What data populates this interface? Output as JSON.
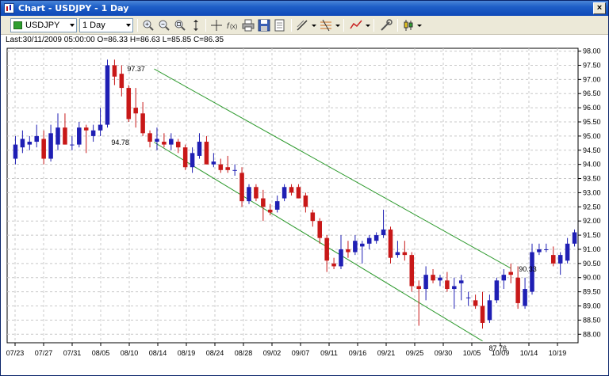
{
  "window": {
    "title": "Chart - USDJPY - 1 Day",
    "close_glyph": "×"
  },
  "toolbar": {
    "symbol": "USDJPY",
    "timeframe": "1 Day",
    "icons": [
      "zoom-in-icon",
      "zoom-out-icon",
      "zoom-fit-icon",
      "autoscale-icon",
      "crosshair-icon",
      "function-icon",
      "print-icon",
      "save-icon",
      "properties-icon",
      "draw-line-icon",
      "fibonacci-icon",
      "indicator-icon",
      "settings-icon",
      "candle-type-icon"
    ]
  },
  "infobar": {
    "text": "Last:30/11/2009 05:00:00 O=86.33 H=86.63 L=85.85 C=86.35"
  },
  "colors": {
    "bull": "#1f1fb4",
    "bear": "#c81818",
    "channel": "#2e9a2e",
    "grid": "#c8c8c8"
  },
  "chart_data": {
    "type": "candlestick",
    "ylim": [
      87.7,
      98.1
    ],
    "y_ticks": [
      "98.00",
      "97.50",
      "97.00",
      "96.50",
      "96.00",
      "95.50",
      "95.00",
      "94.50",
      "94.00",
      "93.50",
      "93.00",
      "92.50",
      "92.00",
      "91.50",
      "91.00",
      "90.50",
      "90.00",
      "89.50",
      "89.00",
      "88.50",
      "88.00"
    ],
    "x_ticks": [
      "07/23",
      "07/27",
      "07/31",
      "08/05",
      "08/10",
      "08/14",
      "08/19",
      "08/24",
      "08/28",
      "09/02",
      "09/07",
      "09/11",
      "09/16",
      "09/21",
      "09/25",
      "09/30",
      "10/05",
      "10/09",
      "10/14",
      "10/19"
    ],
    "candles": [
      {
        "o": 94.2,
        "h": 95.0,
        "l": 94.0,
        "c": 94.7
      },
      {
        "o": 94.6,
        "h": 95.2,
        "l": 94.4,
        "c": 94.9
      },
      {
        "o": 94.7,
        "h": 95.0,
        "l": 94.5,
        "c": 94.8
      },
      {
        "o": 94.8,
        "h": 95.4,
        "l": 94.6,
        "c": 95.0
      },
      {
        "o": 94.9,
        "h": 95.2,
        "l": 94.0,
        "c": 94.2
      },
      {
        "o": 94.2,
        "h": 95.4,
        "l": 94.1,
        "c": 95.1
      },
      {
        "o": 94.7,
        "h": 95.8,
        "l": 94.5,
        "c": 95.3
      },
      {
        "o": 95.3,
        "h": 95.8,
        "l": 94.7,
        "c": 94.7
      },
      {
        "o": 94.7,
        "h": 95.0,
        "l": 94.5,
        "c": 94.7
      },
      {
        "o": 94.7,
        "h": 95.5,
        "l": 94.6,
        "c": 95.3
      },
      {
        "o": 95.3,
        "h": 95.4,
        "l": 94.4,
        "c": 95.2
      },
      {
        "o": 95.0,
        "h": 95.4,
        "l": 94.8,
        "c": 95.2
      },
      {
        "o": 95.2,
        "h": 96.0,
        "l": 95.0,
        "c": 95.4
      },
      {
        "o": 95.4,
        "h": 97.7,
        "l": 95.3,
        "c": 97.5
      },
      {
        "o": 97.5,
        "h": 97.7,
        "l": 96.8,
        "c": 97.1
      },
      {
        "o": 97.2,
        "h": 97.5,
        "l": 96.4,
        "c": 96.7
      },
      {
        "o": 96.7,
        "h": 96.8,
        "l": 95.5,
        "c": 95.6
      },
      {
        "o": 96.0,
        "h": 96.7,
        "l": 95.3,
        "c": 95.8
      },
      {
        "o": 95.8,
        "h": 96.2,
        "l": 95.0,
        "c": 95.1
      },
      {
        "o": 95.1,
        "h": 95.2,
        "l": 94.6,
        "c": 94.8
      },
      {
        "o": 94.8,
        "h": 95.3,
        "l": 94.5,
        "c": 94.9
      },
      {
        "o": 94.8,
        "h": 95.1,
        "l": 94.6,
        "c": 94.7
      },
      {
        "o": 94.7,
        "h": 95.1,
        "l": 94.5,
        "c": 94.9
      },
      {
        "o": 94.8,
        "h": 94.9,
        "l": 94.4,
        "c": 94.6
      },
      {
        "o": 94.6,
        "h": 94.7,
        "l": 93.8,
        "c": 93.9
      },
      {
        "o": 93.9,
        "h": 94.6,
        "l": 93.7,
        "c": 94.4
      },
      {
        "o": 94.3,
        "h": 95.1,
        "l": 94.2,
        "c": 94.8
      },
      {
        "o": 94.8,
        "h": 95.0,
        "l": 94.0,
        "c": 94.0
      },
      {
        "o": 94.0,
        "h": 94.4,
        "l": 93.9,
        "c": 94.1
      },
      {
        "o": 94.0,
        "h": 94.2,
        "l": 93.7,
        "c": 93.8
      },
      {
        "o": 93.9,
        "h": 94.3,
        "l": 93.7,
        "c": 93.8
      },
      {
        "o": 93.8,
        "h": 94.0,
        "l": 93.6,
        "c": 93.8
      },
      {
        "o": 93.7,
        "h": 93.9,
        "l": 92.5,
        "c": 92.7
      },
      {
        "o": 92.7,
        "h": 93.3,
        "l": 92.6,
        "c": 93.2
      },
      {
        "o": 93.2,
        "h": 93.3,
        "l": 92.7,
        "c": 92.8
      },
      {
        "o": 92.8,
        "h": 93.1,
        "l": 92.0,
        "c": 92.5
      },
      {
        "o": 92.4,
        "h": 92.6,
        "l": 92.2,
        "c": 92.3
      },
      {
        "o": 92.4,
        "h": 92.9,
        "l": 92.3,
        "c": 92.7
      },
      {
        "o": 92.8,
        "h": 93.3,
        "l": 92.7,
        "c": 93.2
      },
      {
        "o": 93.2,
        "h": 93.3,
        "l": 92.9,
        "c": 93.0
      },
      {
        "o": 93.2,
        "h": 93.3,
        "l": 92.8,
        "c": 92.8
      },
      {
        "o": 92.9,
        "h": 93.0,
        "l": 92.3,
        "c": 92.5
      },
      {
        "o": 92.3,
        "h": 92.4,
        "l": 91.8,
        "c": 92.0
      },
      {
        "o": 92.0,
        "h": 92.1,
        "l": 91.2,
        "c": 91.4
      },
      {
        "o": 91.4,
        "h": 91.5,
        "l": 90.2,
        "c": 90.6
      },
      {
        "o": 90.5,
        "h": 90.7,
        "l": 90.3,
        "c": 90.4
      },
      {
        "o": 90.4,
        "h": 91.5,
        "l": 90.3,
        "c": 91.0
      },
      {
        "o": 91.0,
        "h": 91.3,
        "l": 90.7,
        "c": 90.9
      },
      {
        "o": 90.9,
        "h": 91.5,
        "l": 90.8,
        "c": 91.3
      },
      {
        "o": 91.1,
        "h": 91.3,
        "l": 90.5,
        "c": 91.2
      },
      {
        "o": 91.2,
        "h": 91.5,
        "l": 91.0,
        "c": 91.4
      },
      {
        "o": 91.3,
        "h": 91.6,
        "l": 91.2,
        "c": 91.5
      },
      {
        "o": 91.5,
        "h": 92.4,
        "l": 91.4,
        "c": 91.7
      },
      {
        "o": 91.7,
        "h": 91.8,
        "l": 90.5,
        "c": 90.7
      },
      {
        "o": 90.8,
        "h": 91.3,
        "l": 90.7,
        "c": 90.9
      },
      {
        "o": 90.9,
        "h": 91.3,
        "l": 90.6,
        "c": 90.8
      },
      {
        "o": 90.8,
        "h": 90.9,
        "l": 89.5,
        "c": 89.7
      },
      {
        "o": 89.7,
        "h": 89.9,
        "l": 88.3,
        "c": 89.6
      },
      {
        "o": 89.6,
        "h": 90.4,
        "l": 89.2,
        "c": 90.1
      },
      {
        "o": 90.1,
        "h": 90.3,
        "l": 89.8,
        "c": 89.9
      },
      {
        "o": 89.9,
        "h": 90.1,
        "l": 89.7,
        "c": 90.0
      },
      {
        "o": 89.9,
        "h": 90.2,
        "l": 89.5,
        "c": 89.6
      },
      {
        "o": 89.6,
        "h": 90.0,
        "l": 88.9,
        "c": 89.7
      },
      {
        "o": 89.8,
        "h": 90.1,
        "l": 89.2,
        "c": 89.9
      },
      {
        "o": 89.3,
        "h": 89.5,
        "l": 89.0,
        "c": 89.3
      },
      {
        "o": 89.2,
        "h": 89.4,
        "l": 88.9,
        "c": 89.0
      },
      {
        "o": 89.0,
        "h": 89.5,
        "l": 88.2,
        "c": 88.4
      },
      {
        "o": 88.5,
        "h": 89.4,
        "l": 88.4,
        "c": 89.2
      },
      {
        "o": 89.2,
        "h": 90.0,
        "l": 89.1,
        "c": 89.9
      },
      {
        "o": 89.9,
        "h": 90.3,
        "l": 89.6,
        "c": 90.1
      },
      {
        "o": 90.2,
        "h": 90.5,
        "l": 89.8,
        "c": 90.1
      },
      {
        "o": 90.0,
        "h": 90.4,
        "l": 88.9,
        "c": 89.1
      },
      {
        "o": 89.0,
        "h": 90.0,
        "l": 88.9,
        "c": 89.6
      },
      {
        "o": 89.5,
        "h": 91.2,
        "l": 89.4,
        "c": 90.9
      },
      {
        "o": 90.9,
        "h": 91.2,
        "l": 90.8,
        "c": 91.0
      },
      {
        "o": 91.0,
        "h": 91.2,
        "l": 90.9,
        "c": 91.0
      },
      {
        "o": 90.8,
        "h": 91.1,
        "l": 90.4,
        "c": 90.5
      },
      {
        "o": 90.5,
        "h": 90.9,
        "l": 90.1,
        "c": 90.8
      },
      {
        "o": 90.6,
        "h": 91.4,
        "l": 90.5,
        "c": 91.2
      },
      {
        "o": 91.2,
        "h": 91.7,
        "l": 91.1,
        "c": 91.6
      }
    ],
    "channel_lines": [
      {
        "from_candle": 14,
        "from_value": 97.37,
        "to_candle": 70,
        "to_value": 90.33
      },
      {
        "from_candle": 14,
        "from_value": 94.78,
        "to_candle": 66,
        "to_value": 87.76
      }
    ],
    "annotations": [
      {
        "text": "97.37",
        "candle": 14,
        "value": 97.37
      },
      {
        "text": "94.78",
        "candle": 14,
        "value": 94.78
      },
      {
        "text": "90.33",
        "candle": 70,
        "value": 90.33
      },
      {
        "text": "87.76",
        "candle": 66,
        "value": 87.76
      }
    ]
  }
}
